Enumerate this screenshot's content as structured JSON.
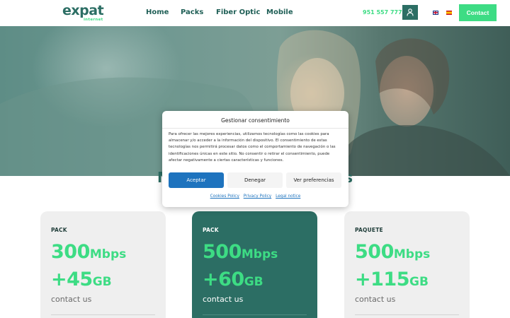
{
  "header": {
    "logo": {
      "word": "expat",
      "sub": "internet"
    },
    "nav": [
      "Home",
      "Packs",
      "Fiber Optic",
      "Mobile"
    ],
    "phone": "951 557 777",
    "user_icon": "user-icon",
    "languages": [
      "en",
      "es"
    ],
    "contact_label": "Contact"
  },
  "section": {
    "title_left": "M",
    "title_right": "s"
  },
  "cards": [
    {
      "tag": "PACK",
      "speed": "300",
      "speed_unit": "Mbps",
      "data": "+45",
      "data_unit": "GB",
      "contact": "contact us"
    },
    {
      "tag": "PACK",
      "speed": "500",
      "speed_unit": "Mbps",
      "data": "+60",
      "data_unit": "GB",
      "contact": "contact us"
    },
    {
      "tag": "PAQUETE",
      "speed": "500",
      "speed_unit": "Mbps",
      "data": "+115",
      "data_unit": "GB",
      "contact": "contact us"
    }
  ],
  "consent": {
    "title": "Gestionar consentimiento",
    "body": "Para ofrecer las mejores experiencias, utilizamos tecnologías como las cookies para almacenar y/o acceder a la información del dispositivo. El consentimiento de estas tecnologías nos permitirá procesar datos como el comportamiento de navegación o las identificaciones únicas en este sitio. No consentir o retirar el consentimiento, puede afectar negativamente a ciertas características y funciones.",
    "accept": "Aceptar",
    "deny": "Denegar",
    "preferences": "Ver preferencias",
    "links": [
      "Cookies Policy",
      "Privacy Policy",
      "Legal notice"
    ]
  },
  "colors": {
    "brand_dark": "#2c6e64",
    "brand_green": "#3ddc84",
    "accept_blue": "#1e73be"
  }
}
